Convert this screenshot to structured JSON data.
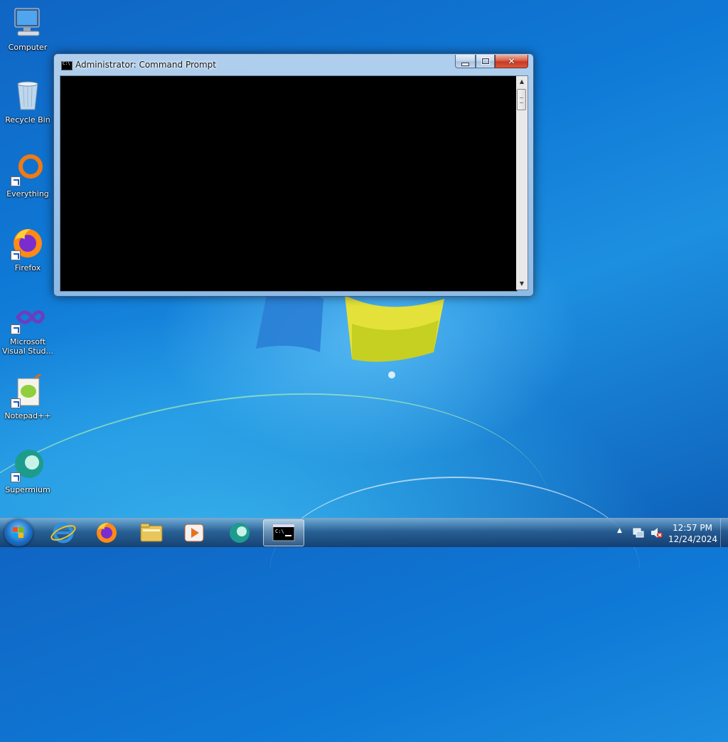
{
  "desktop": {
    "icons": [
      {
        "label": "Computer"
      },
      {
        "label": "Recycle Bin"
      },
      {
        "label": "Everything"
      },
      {
        "label": "Firefox"
      },
      {
        "label": "Microsoft Visual Stud..."
      },
      {
        "label": "Notepad++"
      },
      {
        "label": "Supermium"
      }
    ]
  },
  "window": {
    "title": "Administrator: Command Prompt",
    "icon": "cmd-icon",
    "controls": [
      "minimize-icon",
      "maximize-icon",
      "close-icon"
    ]
  },
  "taskbar": {
    "start_icon": "windows-logo-icon",
    "pinned": [
      "internet-explorer-icon",
      "firefox-icon",
      "file-explorer-icon",
      "media-player-icon",
      "supermium-icon",
      "command-prompt-icon"
    ],
    "active_app": "command-prompt",
    "tray_icons": [
      "show-hidden-icons-icon",
      "network-icon",
      "volume-muted-icon"
    ],
    "time": "12:57 PM",
    "date": "12/24/2024"
  },
  "colors": {
    "console_bg": "#000000",
    "close_button": "#c73a24",
    "desktop_blue": "#1065c3"
  }
}
